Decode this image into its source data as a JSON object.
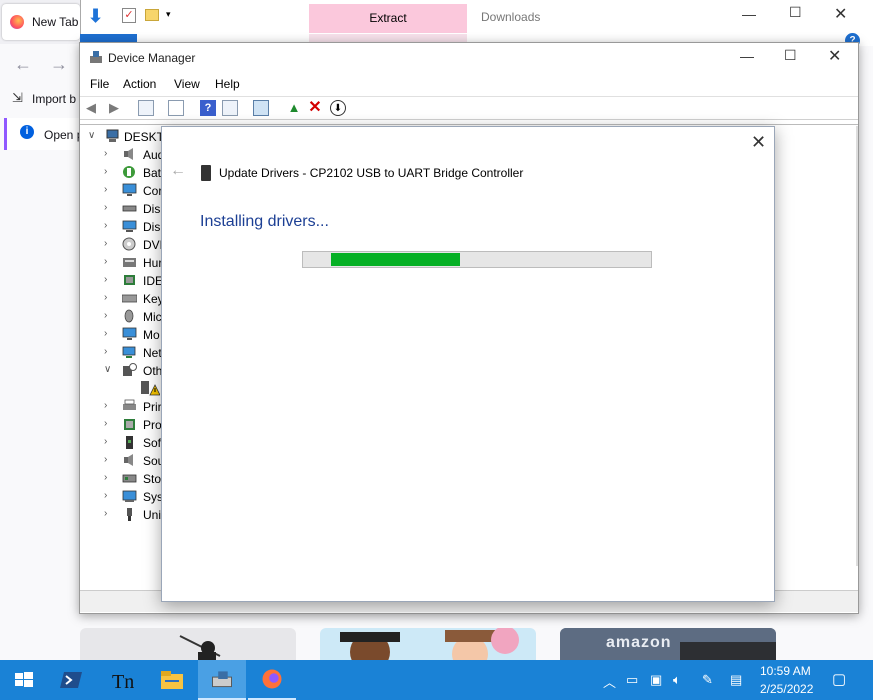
{
  "firefox": {
    "tab_label": "New Tab",
    "import_label": "Import b",
    "open_label": "Open p",
    "card3_text": "amazon"
  },
  "explorer": {
    "extract_label": "Extract",
    "title": "Downloads"
  },
  "device_manager": {
    "title": "Device Manager",
    "menu": [
      "File",
      "Action",
      "View",
      "Help"
    ],
    "tree": {
      "root": "DESKTO",
      "categories": [
        {
          "label": "Aud",
          "icon": "speaker-icon",
          "expanded": false
        },
        {
          "label": "Bat",
          "icon": "battery-icon",
          "expanded": false
        },
        {
          "label": "Cor",
          "icon": "monitor-icon",
          "expanded": false
        },
        {
          "label": "Disl",
          "icon": "disk-drive-icon",
          "expanded": false
        },
        {
          "label": "Disp",
          "icon": "display-adapter-icon",
          "expanded": false
        },
        {
          "label": "DVD",
          "icon": "dvd-drive-icon",
          "expanded": false
        },
        {
          "label": "Hur",
          "icon": "hid-icon",
          "expanded": false
        },
        {
          "label": "IDE",
          "icon": "ide-controller-icon",
          "expanded": false
        },
        {
          "label": "Key",
          "icon": "keyboard-icon",
          "expanded": false
        },
        {
          "label": "Mic",
          "icon": "mouse-icon",
          "expanded": false
        },
        {
          "label": "Mo",
          "icon": "monitor-icon",
          "expanded": false
        },
        {
          "label": "Net",
          "icon": "network-adapter-icon",
          "expanded": false
        },
        {
          "label": "Oth",
          "icon": "other-devices-icon",
          "expanded": true
        },
        {
          "label": "Prir",
          "icon": "printer-icon",
          "expanded": false
        },
        {
          "label": "Pro",
          "icon": "processor-icon",
          "expanded": false
        },
        {
          "label": "Sof",
          "icon": "software-device-icon",
          "expanded": false
        },
        {
          "label": "Sou",
          "icon": "speaker-icon",
          "expanded": false
        },
        {
          "label": "Sto",
          "icon": "storage-controller-icon",
          "expanded": false
        },
        {
          "label": "Sys",
          "icon": "system-devices-icon",
          "expanded": false
        },
        {
          "label": "Uni",
          "icon": "usb-icon",
          "expanded": false
        }
      ]
    }
  },
  "dialog": {
    "title": "Update Drivers - CP2102 USB to UART Bridge Controller",
    "heading": "Installing drivers...",
    "progress_start": 0.08,
    "progress_end": 0.45,
    "progress_color": "#06b025"
  },
  "taskbar": {
    "time": "10:59 AM",
    "date": "2/25/2022",
    "accent": "#1a82d6"
  }
}
